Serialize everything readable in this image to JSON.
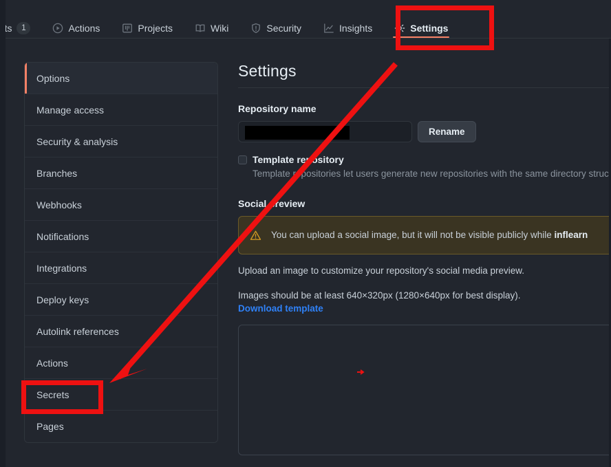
{
  "window": {
    "accent_orange": "#f78166",
    "annotation_red": "#ee1111",
    "link_blue": "#2f81f7",
    "background": "#22262e"
  },
  "topnav": {
    "items": [
      {
        "label": "uests",
        "icon": "pull-request-icon",
        "counter": "1",
        "active": false
      },
      {
        "label": "Actions",
        "icon": "play-circle-icon",
        "counter": null,
        "active": false
      },
      {
        "label": "Projects",
        "icon": "project-board-icon",
        "counter": null,
        "active": false
      },
      {
        "label": "Wiki",
        "icon": "book-icon",
        "counter": null,
        "active": false
      },
      {
        "label": "Security",
        "icon": "shield-icon",
        "counter": null,
        "active": false
      },
      {
        "label": "Insights",
        "icon": "graph-icon",
        "counter": null,
        "active": false
      },
      {
        "label": "Settings",
        "icon": "gear-icon",
        "counter": null,
        "active": true
      }
    ]
  },
  "sidebar": {
    "items": [
      {
        "label": "Options",
        "selected": true
      },
      {
        "label": "Manage access",
        "selected": false
      },
      {
        "label": "Security & analysis",
        "selected": false
      },
      {
        "label": "Branches",
        "selected": false
      },
      {
        "label": "Webhooks",
        "selected": false
      },
      {
        "label": "Notifications",
        "selected": false
      },
      {
        "label": "Integrations",
        "selected": false
      },
      {
        "label": "Deploy keys",
        "selected": false
      },
      {
        "label": "Autolink references",
        "selected": false
      },
      {
        "label": "Actions",
        "selected": false
      },
      {
        "label": "Secrets",
        "selected": false
      },
      {
        "label": "Pages",
        "selected": false
      }
    ]
  },
  "main": {
    "title": "Settings",
    "repository_name": {
      "label": "Repository name",
      "value": "",
      "placeholder": "",
      "redacted": true,
      "rename_button": "Rename"
    },
    "template_repository": {
      "checked": false,
      "title": "Template repository",
      "description": "Template repositories let users generate new repositories with the same directory structure a"
    },
    "social_preview": {
      "title": "Social preview",
      "warning": {
        "icon": "alert-triangle-icon",
        "text_before": "You can upload a social image, but it will not be visible publicly while ",
        "text_bold": "inflearn"
      },
      "upload_text": "Upload an image to customize your repository's social media preview.",
      "size_text": "Images should be at least 640×320px (1280×640px for best display).",
      "download_link": "Download template"
    }
  },
  "annotations": {
    "settings_box": "highlight-settings-tab",
    "secrets_box": "highlight-secrets-item",
    "arrow": "arrow-settings-to-secrets"
  }
}
